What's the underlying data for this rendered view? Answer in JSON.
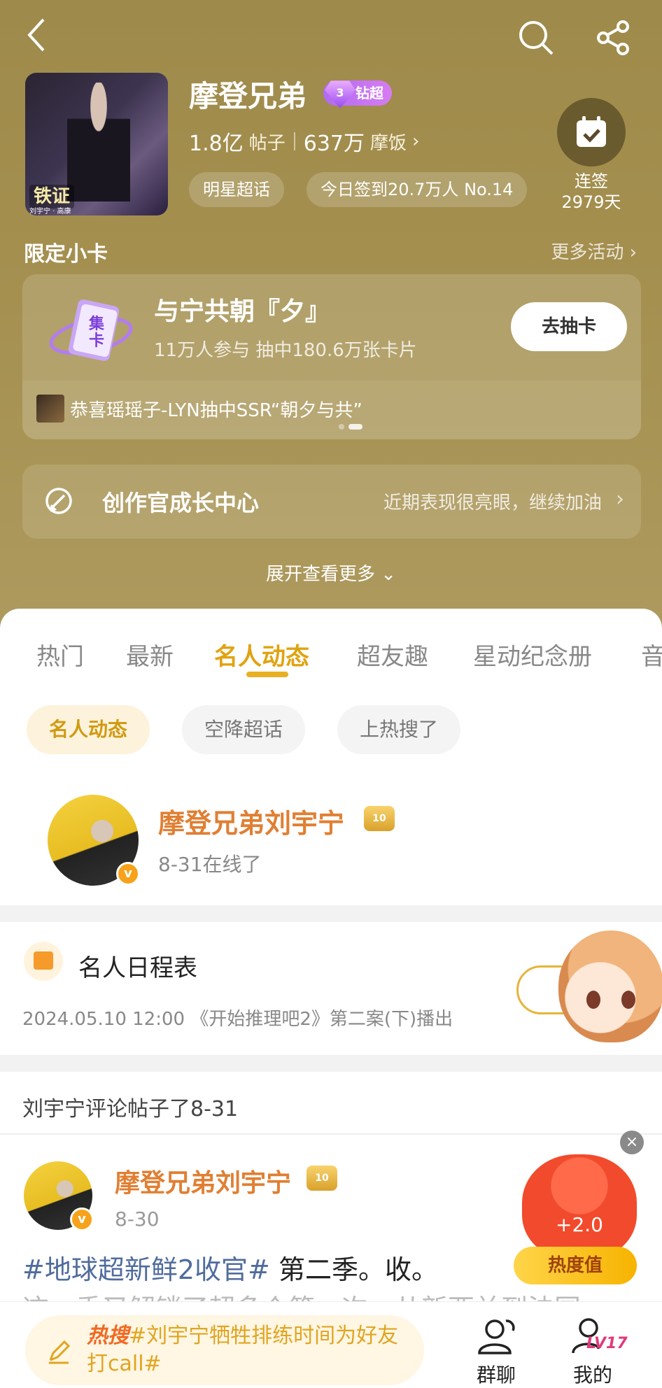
{
  "header": {
    "super_name": "摩登兄弟",
    "diamond_badge": "钻超",
    "diamond_level": "3",
    "posts_count": "1.8亿",
    "posts_label": "帖子",
    "fans_count": "637万",
    "fans_label": "摩饭",
    "category_pill": "明星超话",
    "checkin_pill": "今日签到20.7万人 No.14",
    "checkin_streak_line1": "连签",
    "checkin_streak_line2": "2979天",
    "cover_title": "铁证",
    "cover_subtitle": "刘宇宁 · 高康"
  },
  "limited_card": {
    "section_title": "限定小卡",
    "more_link": "更多活动",
    "title": "与宁共朝『夕』",
    "subtitle": "11万人参与 抽中180.6万张卡片",
    "button": "去抽卡",
    "icon_text": "集卡",
    "ticker": "恭喜瑶瑶子-LYN抽中SSR“朝夕与共”"
  },
  "growth": {
    "title": "创作官成长中心",
    "subtitle": "近期表现很亮眼，继续加油"
  },
  "expand_label": "展开查看更多",
  "tabs": [
    "热门",
    "最新",
    "名人动态",
    "超友趣",
    "星动纪念册",
    "音"
  ],
  "active_tab": "名人动态",
  "chips": [
    "名人动态",
    "空降超话",
    "上热搜了"
  ],
  "celebrity": {
    "name": "摩登兄弟刘宇宁",
    "status": "8-31在线了",
    "crown_level": "10"
  },
  "schedule": {
    "title": "名人日程表",
    "item": "2024.05.10 12:00 《开始推理吧2》第二案(下)播出"
  },
  "comment_section": {
    "header": "刘宇宁评论帖子了8-31"
  },
  "post": {
    "author": "摩登兄弟刘宇宁",
    "date": "8-30",
    "hashtag": "#地球超新鲜2收官#",
    "text": " 第二季。收。",
    "text_line2": "这一季又解锁了超多个第一次，从新西兰到法国"
  },
  "heat": {
    "value": "+2.0",
    "label": "热度值"
  },
  "bottom_bar": {
    "hot_prefix": "热搜",
    "compose_text": "#刘宇宁牺牲排练时间为好友打call#",
    "group_chat_label": "群聊",
    "mine_label": "我的",
    "level": "LV17"
  }
}
